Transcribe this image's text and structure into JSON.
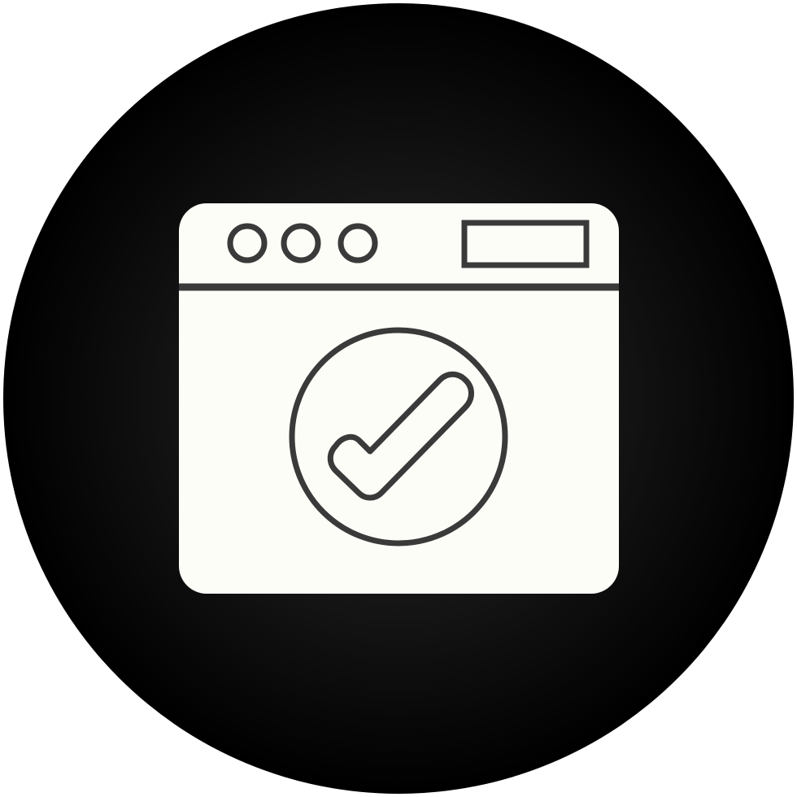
{
  "icon": {
    "name": "browser-window-check-icon",
    "colors": {
      "background": "#ffffff",
      "disc_center": "#2e2e2e",
      "disc_edge": "#000000",
      "window_fill": "#fdfdf8",
      "stroke": "#3a3a3a"
    }
  }
}
